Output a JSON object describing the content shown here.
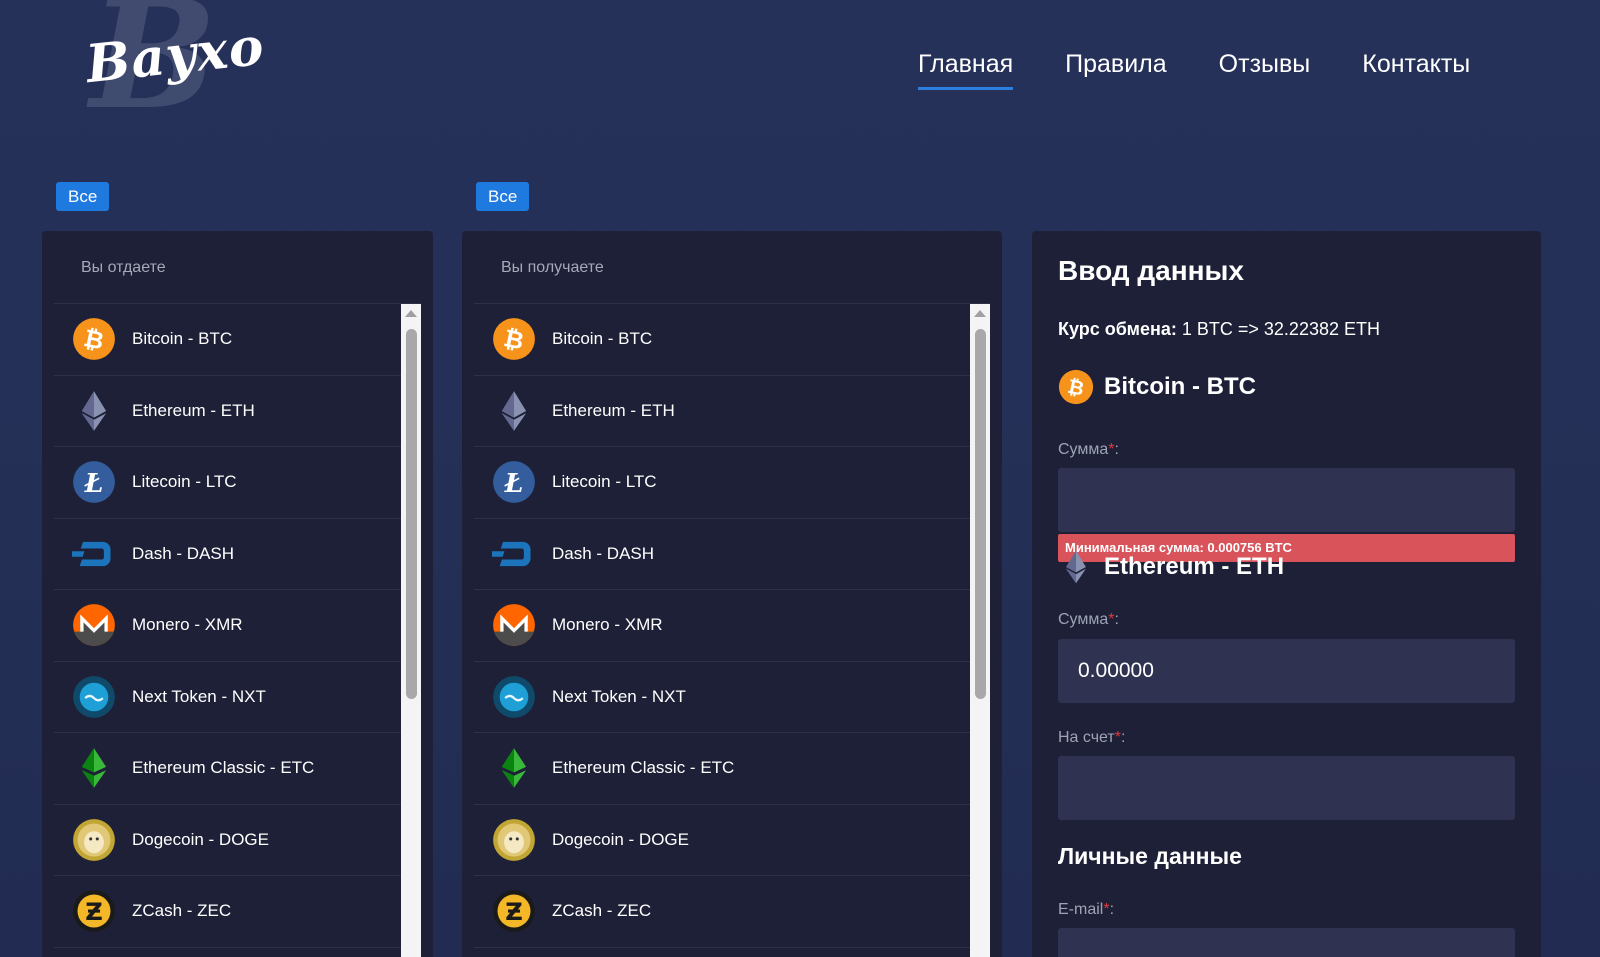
{
  "header": {
    "brand": "Bayxo",
    "brand_mark": "B",
    "nav": [
      {
        "label": "Главная",
        "active": true
      },
      {
        "label": "Правила",
        "active": false
      },
      {
        "label": "Отзывы",
        "active": false
      },
      {
        "label": "Контакты",
        "active": false
      }
    ]
  },
  "filters": {
    "all_label": "Все"
  },
  "give_panel": {
    "title": "Вы отдаете"
  },
  "get_panel": {
    "title": "Вы получаете"
  },
  "currencies": [
    {
      "label": "Bitcoin - BTC",
      "icon": "bitcoin-icon"
    },
    {
      "label": "Ethereum - ETH",
      "icon": "ethereum-icon"
    },
    {
      "label": "Litecoin - LTC",
      "icon": "litecoin-icon"
    },
    {
      "label": "Dash - DASH",
      "icon": "dash-icon"
    },
    {
      "label": "Monero - XMR",
      "icon": "monero-icon"
    },
    {
      "label": "Next Token - NXT",
      "icon": "nxt-icon"
    },
    {
      "label": "Ethereum Classic - ETC",
      "icon": "ethereum-classic-icon"
    },
    {
      "label": "Dogecoin - DOGE",
      "icon": "dogecoin-icon"
    },
    {
      "label": "ZCash - ZEC",
      "icon": "zcash-icon"
    }
  ],
  "form": {
    "title": "Ввод данных",
    "rate_label": "Курс обмена:",
    "rate_value": "1 BTC => 32.22382 ETH",
    "from_currency": "Bitcoin - BTC",
    "to_currency": "Ethereum - ETH",
    "amount_label": "Сумма",
    "required_mark": "*",
    "colon": ":",
    "from_amount_value": "",
    "min_error": "Минимальная сумма: 0.000756 BTC",
    "to_amount_value": "0.00000",
    "account_label": "На счет",
    "account_value": "",
    "personal_title": "Личные данные",
    "email_label": "E-mail",
    "email_value": ""
  },
  "colors": {
    "background": "#243057",
    "panel": "#1d2036",
    "accent": "#1f7ae0",
    "error": "#d9535a",
    "input": "#2f3250"
  }
}
